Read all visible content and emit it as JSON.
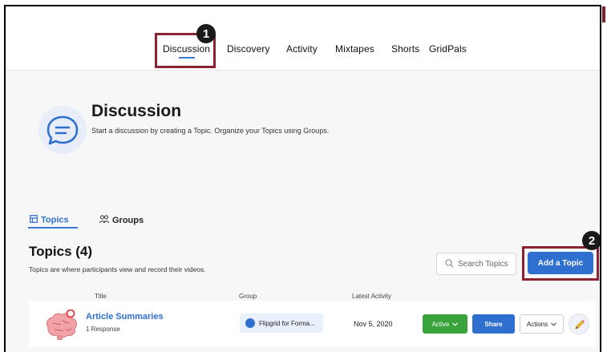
{
  "nav": {
    "items": [
      "Discussion",
      "Discovery",
      "Activity",
      "Mixtapes",
      "Shorts",
      "GridPals"
    ],
    "active": "Discussion"
  },
  "callouts": {
    "one": "1",
    "two": "2"
  },
  "header": {
    "title": "Discussion",
    "subtitle": "Start a discussion by creating a Topic. Organize your Topics using Groups."
  },
  "tabs": {
    "topics": "Topics",
    "groups": "Groups"
  },
  "topics_section": {
    "title": "Topics (4)",
    "subtitle": "Topics are where participants view and record their videos.",
    "search_placeholder": "Search Topics",
    "add_button": "Add a Topic"
  },
  "table": {
    "headers": {
      "title": "Title",
      "group": "Group",
      "latest": "Latest Activity"
    },
    "rows": [
      {
        "title": "Article Summaries",
        "responses": "1 Response",
        "group": "Flipgrid for Forma...",
        "latest": "Nov 5, 2020",
        "status": "Active",
        "share": "Share",
        "actions": "Actions"
      }
    ]
  },
  "colors": {
    "accent": "#2f6fd0",
    "success": "#3aa43c",
    "highlight": "#8b2232"
  }
}
